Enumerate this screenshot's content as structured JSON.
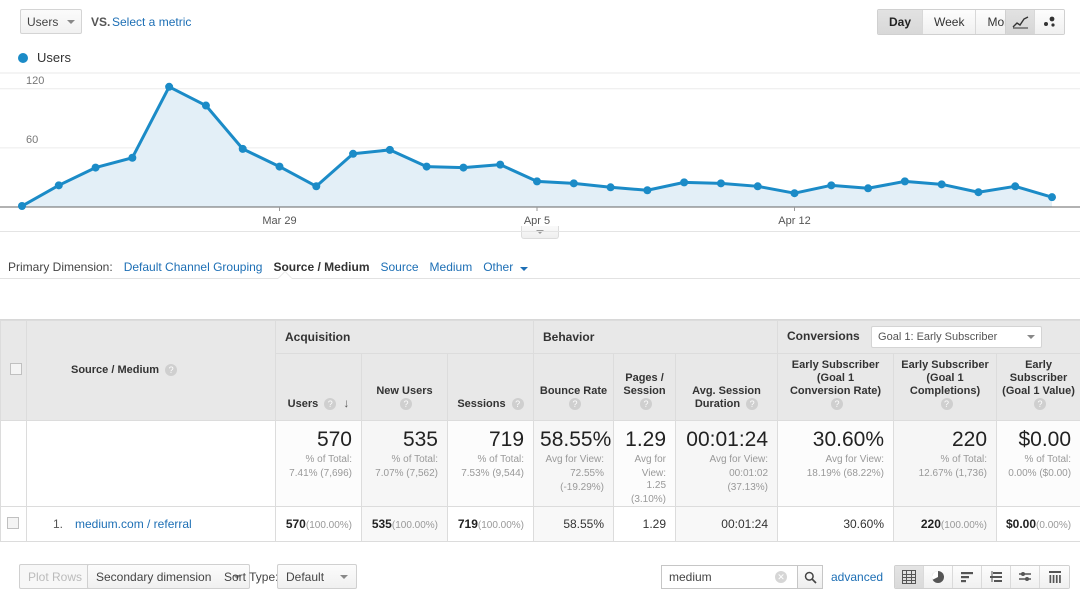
{
  "metric_bar": {
    "primary_metric": "Users",
    "vs_label": "VS.",
    "select_metric_link": "Select a metric",
    "granularity": [
      {
        "label": "Day",
        "active": true
      },
      {
        "label": "Week",
        "active": false
      },
      {
        "label": "Month",
        "active": false
      }
    ],
    "chart_types": [
      {
        "name": "line-chart-icon",
        "active": true
      },
      {
        "name": "motion-chart-icon",
        "active": false
      }
    ]
  },
  "chart_data": {
    "type": "area",
    "title": "Users",
    "series_name": "Users",
    "xlabel": "",
    "ylabel": "Users",
    "ylim": [
      0,
      135
    ],
    "yticks": [
      60,
      120
    ],
    "ytick_labels": [
      "60",
      "120"
    ],
    "grid": true,
    "legend_position": "top-left",
    "line_color": "#1b8bc7",
    "fill_color": "#e3eff7",
    "x_tick_labels": [
      "Mar 29",
      "Apr 5",
      "Apr 12"
    ],
    "x_tick_indices": [
      7,
      14,
      21
    ],
    "categories": [
      "Mar 22",
      "Mar 23",
      "Mar 24",
      "Mar 25",
      "Mar 26",
      "Mar 27",
      "Mar 28",
      "Mar 29",
      "Mar 30",
      "Mar 31",
      "Apr 1",
      "Apr 2",
      "Apr 3",
      "Apr 4",
      "Apr 5",
      "Apr 6",
      "Apr 7",
      "Apr 8",
      "Apr 9",
      "Apr 10",
      "Apr 11",
      "Apr 12",
      "Apr 13",
      "Apr 14",
      "Apr 15",
      "Apr 16",
      "Apr 17",
      "Apr 18"
    ],
    "values": [
      1,
      22,
      40,
      50,
      122,
      103,
      59,
      41,
      21,
      54,
      58,
      41,
      40,
      43,
      26,
      24,
      20,
      17,
      25,
      24,
      21,
      14,
      22,
      19,
      26,
      23,
      15,
      21,
      10
    ]
  },
  "chart_collapse": {
    "icon": "chevron-down-icon"
  },
  "primary_dimension": {
    "label": "Primary Dimension:",
    "options": [
      {
        "label": "Default Channel Grouping",
        "active": false
      },
      {
        "label": "Source / Medium",
        "active": true
      },
      {
        "label": "Source",
        "active": false
      },
      {
        "label": "Medium",
        "active": false
      }
    ],
    "other_label": "Other"
  },
  "table_controls": {
    "plot_rows": "Plot Rows",
    "secondary_dimension": "Secondary dimension",
    "sort_type_label": "Sort Type:",
    "sort_type_value": "Default",
    "search_value": "medium",
    "search_placeholder": "",
    "advanced_link": "advanced",
    "view_icons": [
      {
        "name": "table-view-icon",
        "active": true
      },
      {
        "name": "percentage-view-icon",
        "active": false
      },
      {
        "name": "performance-view-icon",
        "active": false
      },
      {
        "name": "comparison-view-icon",
        "active": false
      },
      {
        "name": "term-cloud-view-icon",
        "active": false
      },
      {
        "name": "pivot-view-icon",
        "active": false
      }
    ]
  },
  "table": {
    "groups": [
      {
        "label": "Acquisition",
        "span": 3
      },
      {
        "label": "Behavior",
        "span": 3
      },
      {
        "label": "Conversions",
        "span": 3,
        "goal_select": "Goal 1: Early Subscriber"
      }
    ],
    "dimension_header": "Source / Medium",
    "columns": [
      {
        "label": "Users",
        "sorted": true
      },
      {
        "label": "New Users"
      },
      {
        "label": "Sessions"
      },
      {
        "label": "Bounce Rate"
      },
      {
        "label": "Pages / Session"
      },
      {
        "label": "Avg. Session Duration"
      },
      {
        "label": "Early Subscriber (Goal 1 Conversion Rate)"
      },
      {
        "label": "Early Subscriber (Goal 1 Completions)"
      },
      {
        "label": "Early Subscriber (Goal 1 Value)"
      }
    ],
    "summary": [
      {
        "value": "570",
        "sub1": "% of Total:",
        "sub2": "7.41% (7,696)"
      },
      {
        "value": "535",
        "sub1": "% of Total:",
        "sub2": "7.07% (7,562)"
      },
      {
        "value": "719",
        "sub1": "% of Total:",
        "sub2": "7.53% (9,544)"
      },
      {
        "value": "58.55%",
        "sub1": "Avg for View:",
        "sub2": "72.55%",
        "sub3": "(-19.29%)"
      },
      {
        "value": "1.29",
        "sub1": "Avg for",
        "sub2": "View: 1.25",
        "sub3": "(3.10%)"
      },
      {
        "value": "00:01:24",
        "sub1": "Avg for View:",
        "sub2": "00:01:02",
        "sub3": "(37.13%)"
      },
      {
        "value": "30.60%",
        "sub1": "Avg for View:",
        "sub2": "18.19% (68.22%)"
      },
      {
        "value": "220",
        "sub1": "% of Total:",
        "sub2": "12.67% (1,736)"
      },
      {
        "value": "$0.00",
        "sub1": "% of Total:",
        "sub2": "0.00% ($0.00)"
      }
    ],
    "rows": [
      {
        "index": "1.",
        "dimension": "medium.com / referral",
        "cells": [
          {
            "value": "570",
            "pct": "(100.00%)",
            "bold": true
          },
          {
            "value": "535",
            "pct": "(100.00%)",
            "bold": true
          },
          {
            "value": "719",
            "pct": "(100.00%)",
            "bold": true
          },
          {
            "value": "58.55%",
            "pct": ""
          },
          {
            "value": "1.29",
            "pct": ""
          },
          {
            "value": "00:01:24",
            "pct": ""
          },
          {
            "value": "30.60%",
            "pct": ""
          },
          {
            "value": "220",
            "pct": "(100.00%)",
            "bold": true
          },
          {
            "value": "$0.00",
            "pct": "(0.00%)",
            "bold": true
          }
        ]
      }
    ]
  }
}
